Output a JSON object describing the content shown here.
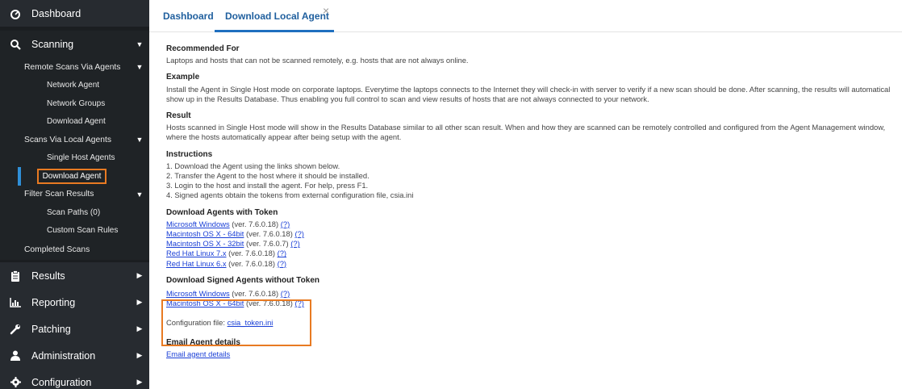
{
  "sidebar": {
    "dashboard": "Dashboard",
    "scanning": "Scanning",
    "remote_scans": "Remote Scans Via Agents",
    "network_agent": "Network Agent",
    "network_groups": "Network Groups",
    "download_agent_remote": "Download Agent",
    "scans_local": "Scans Via Local Agents",
    "single_host_agents": "Single Host Agents",
    "download_agent_local": "Download Agent",
    "filter_scan_results": "Filter Scan Results",
    "scan_paths": "Scan Paths (0)",
    "custom_scan_rules": "Custom Scan Rules",
    "completed_scans": "Completed Scans",
    "results": "Results",
    "reporting": "Reporting",
    "patching": "Patching",
    "administration": "Administration",
    "configuration": "Configuration"
  },
  "tabs": {
    "dashboard": "Dashboard",
    "download_local_agent": "Download Local Agent",
    "close": "×"
  },
  "content": {
    "recommended_h": "Recommended For",
    "recommended_p": "Laptops and hosts that can not be scanned remotely, e.g. hosts that are not always online.",
    "example_h": "Example",
    "example_p1": "Install the Agent in Single Host mode on corporate laptops. Everytime the laptops connects to the Internet they will check-in with server to verify if a new scan should be done. After scanning, the results will automatical",
    "example_p2": "show up in the Results Database. Thus enabling you full control to scan and view results of hosts that are not always connected to your network.",
    "result_h": "Result",
    "result_p1": "Hosts scanned in Single Host mode will show in the Results Database similar to all other scan result. When and how they are scanned can be remotely controlled and configured from the Agent Management window,",
    "result_p2": "where the hosts automatically appear after being setup with the agent.",
    "instructions_h": "Instructions",
    "instr_1": "1. Download the Agent using the links shown below.",
    "instr_2": "2. Transfer the Agent to the host where it should be installed.",
    "instr_3": "3. Login to the host and install the agent. For help, press F1.",
    "instr_4": "4. Signed agents obtain the tokens from external configuration file, csia.ini",
    "with_token_h": "Download Agents with Token",
    "with_token": [
      {
        "name": "Microsoft Windows",
        "ver": "(ver. 7.6.0.18)",
        "help": "(?)"
      },
      {
        "name": "Macintosh OS X - 64bit",
        "ver": "(ver. 7.6.0.18)",
        "help": "(?)"
      },
      {
        "name": "Macintosh OS X - 32bit",
        "ver": "(ver. 7.6.0.7)",
        "help": "(?)"
      },
      {
        "name": "Red Hat Linux 7.x",
        "ver": "(ver. 7.6.0.18)",
        "help": "(?)"
      },
      {
        "name": "Red Hat Linux 6.x",
        "ver": "(ver. 7.6.0.18)",
        "help": "(?)"
      }
    ],
    "signed_h": "Download Signed Agents without Token",
    "signed": [
      {
        "name": "Microsoft Windows",
        "ver": "(ver. 7.6.0.18)",
        "help": "(?)"
      },
      {
        "name": "Macintosh OS X - 64bit",
        "ver": "(ver. 7.6.0.18)",
        "help": "(?)"
      }
    ],
    "config_label": "Configuration file:",
    "config_file": "csia_token.ini",
    "email_h": "Email Agent details",
    "email_link": "Email agent details"
  },
  "colors": {
    "sidebar_bg": "#272b30",
    "highlight": "#e87a22",
    "active_bar": "#2f8fd8",
    "link": "#1a3fd6",
    "tab_text": "#1f5f9e"
  },
  "icons": {
    "dashboard": "tachometer-icon",
    "scanning": "search-icon",
    "results": "clipboard-icon",
    "reporting": "chart-icon",
    "patching": "wrench-icon",
    "administration": "user-icon",
    "configuration": "gear-icon"
  }
}
